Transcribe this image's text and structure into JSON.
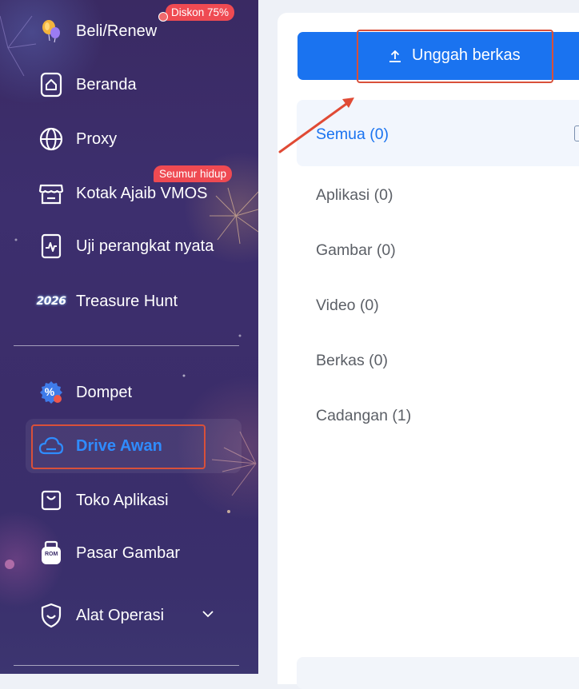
{
  "sidebar": {
    "items": [
      {
        "label": "Beli/Renew",
        "icon": "balloon-icon"
      },
      {
        "label": "Beranda",
        "icon": "home-icon"
      },
      {
        "label": "Proxy",
        "icon": "globe-icon"
      },
      {
        "label": "Kotak Ajaib VMOS",
        "icon": "store-icon"
      },
      {
        "label": "Uji perangkat nyata",
        "icon": "device-test-icon"
      },
      {
        "label": "Treasure Hunt",
        "icon": "year-2026-icon"
      },
      {
        "label": "Dompet",
        "icon": "wallet-badge-icon"
      },
      {
        "label": "Drive Awan",
        "icon": "cloud-icon"
      },
      {
        "label": "Toko Aplikasi",
        "icon": "bag-icon"
      },
      {
        "label": "Pasar Gambar",
        "icon": "rom-icon"
      },
      {
        "label": "Alat Operasi",
        "icon": "shield-icon"
      }
    ],
    "badges": {
      "discount": "Diskon 75%",
      "lifetime": "Seumur hidup"
    },
    "year_logo": "2026",
    "rom_label": "ROM",
    "wallet_badge": "%"
  },
  "main": {
    "upload_label": "Unggah berkas",
    "categories": [
      {
        "label": "Semua (0)"
      },
      {
        "label": "Aplikasi (0)"
      },
      {
        "label": "Gambar (0)"
      },
      {
        "label": "Video (0)"
      },
      {
        "label": "Berkas (0)"
      },
      {
        "label": "Cadangan (1)"
      }
    ]
  },
  "colors": {
    "accent": "#1a73f0",
    "highlight": "#d9503a",
    "badge": "#ef4a52",
    "active_label": "#2f8cff"
  }
}
